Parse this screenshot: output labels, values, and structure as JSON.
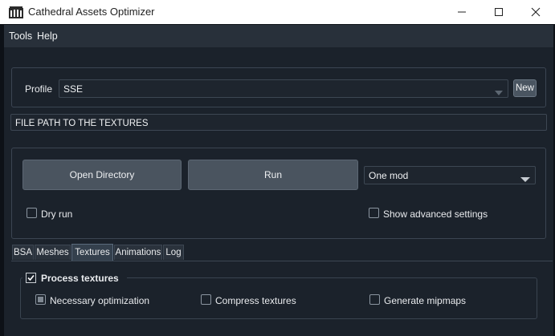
{
  "window": {
    "title": "Cathedral Assets Optimizer",
    "app_icon": "cathedral-icon",
    "controls": [
      "minimize-icon",
      "maximize-icon",
      "close-icon"
    ]
  },
  "menubar": {
    "items": [
      "Tools",
      "Help"
    ]
  },
  "profile": {
    "label": "Profile",
    "selected": "SSE",
    "new_button": "New"
  },
  "path_field": {
    "value": "FILE PATH TO THE TEXTURES"
  },
  "actions": {
    "open_directory": "Open Directory",
    "run": "Run",
    "mode_selected": "One mod",
    "dry_run_label": "Dry run",
    "dry_run_checked": false,
    "advanced_label": "Show advanced settings",
    "advanced_checked": false
  },
  "tabs": {
    "items": [
      "BSA",
      "Meshes",
      "Textures",
      "Animations",
      "Log"
    ],
    "active": "Textures"
  },
  "textures_panel": {
    "group_title": "Process textures",
    "group_checked": true,
    "options": [
      {
        "label": "Necessary optimization",
        "state": "partial"
      },
      {
        "label": "Compress textures",
        "state": "unchecked"
      },
      {
        "label": "Generate mipmaps",
        "state": "unchecked"
      }
    ]
  },
  "colors": {
    "background": "#1b222b",
    "menubar": "#28303a",
    "button": "#4a545f",
    "border": "#3d4753",
    "text": "#e6e8ea"
  }
}
